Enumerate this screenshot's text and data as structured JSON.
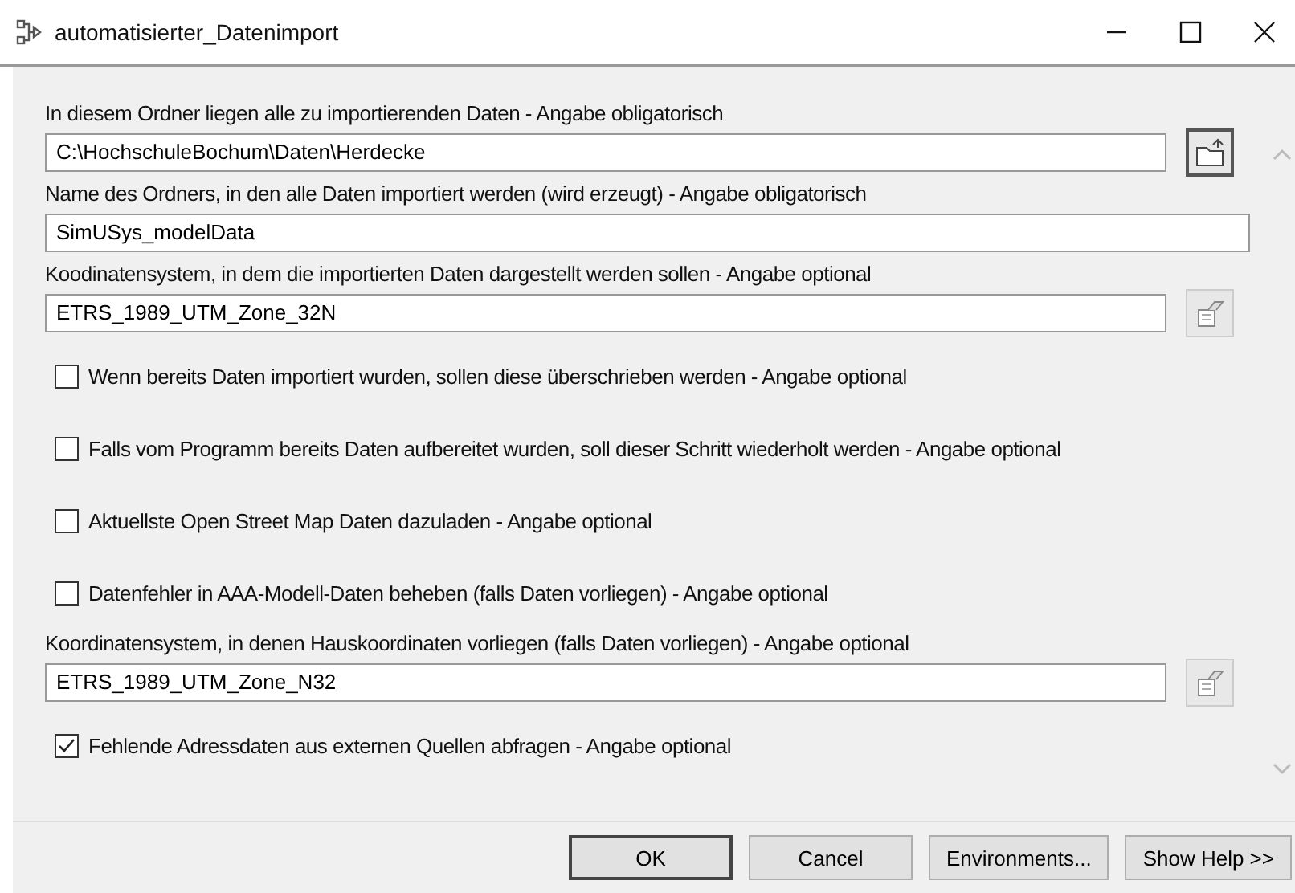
{
  "window": {
    "title": "automatisierter_Datenimport"
  },
  "parameters": [
    {
      "kind": "folder",
      "label": "In diesem Ordner liegen alle zu importierenden Daten - Angabe obligatorisch",
      "value": "C:\\HochschuleBochum\\Daten\\Herdecke"
    },
    {
      "kind": "text",
      "label": "Name des Ordners, in den alle Daten importiert werden (wird erzeugt) - Angabe obligatorisch",
      "value": "SimUSys_modelData"
    },
    {
      "kind": "coordsys",
      "label": "Koodinatensystem, in dem die importierten Daten dargestellt werden sollen - Angabe optional",
      "value": "ETRS_1989_UTM_Zone_32N"
    },
    {
      "kind": "checkbox",
      "label": "Wenn bereits Daten importiert wurden, sollen diese überschrieben werden - Angabe optional",
      "checked": false
    },
    {
      "kind": "checkbox",
      "label": "Falls vom Programm bereits Daten aufbereitet wurden, soll dieser Schritt wiederholt werden - Angabe optional",
      "checked": false
    },
    {
      "kind": "checkbox",
      "label": "Aktuellste Open Street Map Daten dazuladen - Angabe optional",
      "checked": false
    },
    {
      "kind": "checkbox",
      "label": "Datenfehler in AAA-Modell-Daten beheben (falls Daten vorliegen) - Angabe optional",
      "checked": false
    },
    {
      "kind": "coordsys",
      "label": "Koordinatensystem, in denen Hauskoordinaten vorliegen (falls Daten vorliegen) - Angabe optional",
      "value": "ETRS_1989_UTM_Zone_N32"
    },
    {
      "kind": "checkbox",
      "label": "Fehlende Adressdaten aus externen Quellen abfragen - Angabe optional",
      "checked": true
    }
  ],
  "buttons": [
    {
      "label": "OK",
      "selected": true
    },
    {
      "label": "Cancel",
      "selected": false
    },
    {
      "label": "Environments...",
      "selected": false
    },
    {
      "label": "Show Help >>",
      "selected": false
    }
  ]
}
